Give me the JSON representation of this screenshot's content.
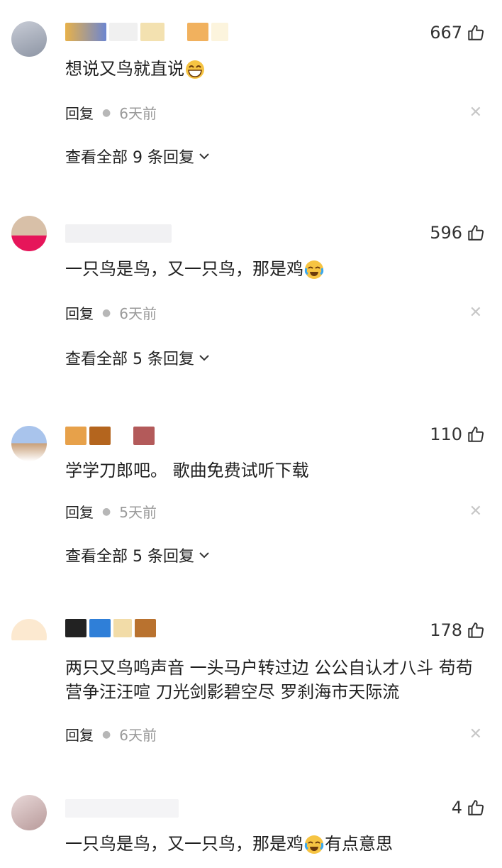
{
  "comments": [
    {
      "likes": "667",
      "text": "想说又鸟就直说",
      "emoji": "grin-emoji",
      "reply": "回复",
      "time": "6天前",
      "view": "查看全部 9 条回复"
    },
    {
      "likes": "596",
      "text": "一只鸟是鸟，又一只鸟，那是鸡",
      "emoji": "crying-laugh-emoji",
      "reply": "回复",
      "time": "6天前",
      "view": "查看全部 5 条回复"
    },
    {
      "likes": "110",
      "text": "学学刀郎吧。 歌曲免费试听下载",
      "reply": "回复",
      "time": "5天前",
      "view": "查看全部 5 条回复"
    },
    {
      "likes": "178",
      "text": "两只又鸟鸣声音 一头马户转过边 公公自认才八斗 苟苟营争汪汪喧 刀光剑影碧空尽 罗刹海市天际流",
      "reply": "回复",
      "time": "6天前"
    },
    {
      "likes": "4",
      "text": "一只鸟是鸟，又一只鸟，那是鸡",
      "text_suffix": "有点意思",
      "emoji": "crying-laugh-emoji"
    }
  ],
  "icons": {
    "like": "thumbs-up-icon",
    "close": "close-icon",
    "chevron": "chevron-down-icon"
  },
  "colors": {
    "text": "#1f1f1f",
    "muted": "#9a9a9a"
  }
}
